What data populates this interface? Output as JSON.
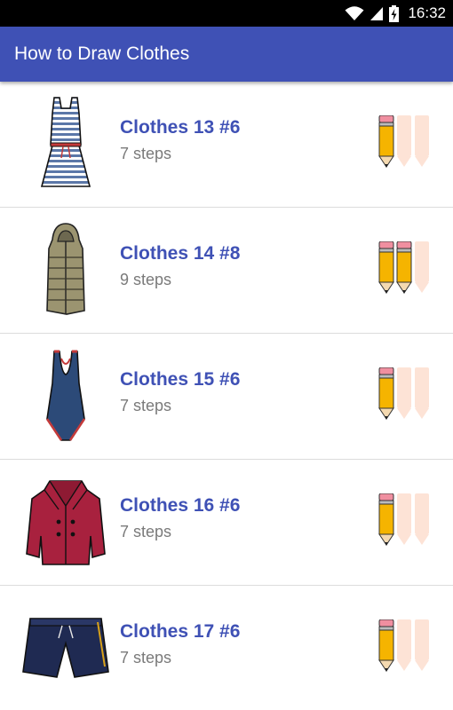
{
  "status_bar": {
    "time": "16:32"
  },
  "app_bar": {
    "title": "How to Draw Clothes"
  },
  "items": [
    {
      "title": "Clothes 13 #6",
      "steps": "7 steps",
      "difficulty": 1,
      "icon": "striped-dress-icon"
    },
    {
      "title": "Clothes 14 #8",
      "steps": "9 steps",
      "difficulty": 2,
      "icon": "puffer-vest-icon"
    },
    {
      "title": "Clothes 15 #6",
      "steps": "7 steps",
      "difficulty": 1,
      "icon": "swimsuit-icon"
    },
    {
      "title": "Clothes 16 #6",
      "steps": "7 steps",
      "difficulty": 1,
      "icon": "pea-coat-icon"
    },
    {
      "title": "Clothes 17 #6",
      "steps": "7 steps",
      "difficulty": 1,
      "icon": "shorts-icon"
    }
  ],
  "colors": {
    "primary": "#3f51b5",
    "pencil_active": "#f5b400",
    "pencil_inactive": "#fde3d6"
  }
}
